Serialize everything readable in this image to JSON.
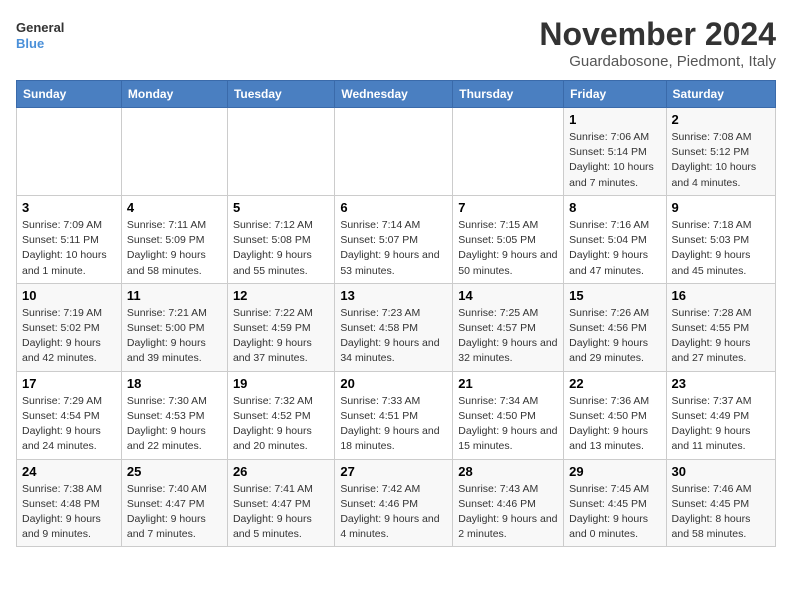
{
  "header": {
    "logo_line1": "General",
    "logo_line2": "Blue",
    "month_title": "November 2024",
    "location": "Guardabosone, Piedmont, Italy"
  },
  "weekdays": [
    "Sunday",
    "Monday",
    "Tuesday",
    "Wednesday",
    "Thursday",
    "Friday",
    "Saturday"
  ],
  "weeks": [
    [
      {
        "day": "",
        "info": ""
      },
      {
        "day": "",
        "info": ""
      },
      {
        "day": "",
        "info": ""
      },
      {
        "day": "",
        "info": ""
      },
      {
        "day": "",
        "info": ""
      },
      {
        "day": "1",
        "info": "Sunrise: 7:06 AM\nSunset: 5:14 PM\nDaylight: 10 hours and 7 minutes."
      },
      {
        "day": "2",
        "info": "Sunrise: 7:08 AM\nSunset: 5:12 PM\nDaylight: 10 hours and 4 minutes."
      }
    ],
    [
      {
        "day": "3",
        "info": "Sunrise: 7:09 AM\nSunset: 5:11 PM\nDaylight: 10 hours and 1 minute."
      },
      {
        "day": "4",
        "info": "Sunrise: 7:11 AM\nSunset: 5:09 PM\nDaylight: 9 hours and 58 minutes."
      },
      {
        "day": "5",
        "info": "Sunrise: 7:12 AM\nSunset: 5:08 PM\nDaylight: 9 hours and 55 minutes."
      },
      {
        "day": "6",
        "info": "Sunrise: 7:14 AM\nSunset: 5:07 PM\nDaylight: 9 hours and 53 minutes."
      },
      {
        "day": "7",
        "info": "Sunrise: 7:15 AM\nSunset: 5:05 PM\nDaylight: 9 hours and 50 minutes."
      },
      {
        "day": "8",
        "info": "Sunrise: 7:16 AM\nSunset: 5:04 PM\nDaylight: 9 hours and 47 minutes."
      },
      {
        "day": "9",
        "info": "Sunrise: 7:18 AM\nSunset: 5:03 PM\nDaylight: 9 hours and 45 minutes."
      }
    ],
    [
      {
        "day": "10",
        "info": "Sunrise: 7:19 AM\nSunset: 5:02 PM\nDaylight: 9 hours and 42 minutes."
      },
      {
        "day": "11",
        "info": "Sunrise: 7:21 AM\nSunset: 5:00 PM\nDaylight: 9 hours and 39 minutes."
      },
      {
        "day": "12",
        "info": "Sunrise: 7:22 AM\nSunset: 4:59 PM\nDaylight: 9 hours and 37 minutes."
      },
      {
        "day": "13",
        "info": "Sunrise: 7:23 AM\nSunset: 4:58 PM\nDaylight: 9 hours and 34 minutes."
      },
      {
        "day": "14",
        "info": "Sunrise: 7:25 AM\nSunset: 4:57 PM\nDaylight: 9 hours and 32 minutes."
      },
      {
        "day": "15",
        "info": "Sunrise: 7:26 AM\nSunset: 4:56 PM\nDaylight: 9 hours and 29 minutes."
      },
      {
        "day": "16",
        "info": "Sunrise: 7:28 AM\nSunset: 4:55 PM\nDaylight: 9 hours and 27 minutes."
      }
    ],
    [
      {
        "day": "17",
        "info": "Sunrise: 7:29 AM\nSunset: 4:54 PM\nDaylight: 9 hours and 24 minutes."
      },
      {
        "day": "18",
        "info": "Sunrise: 7:30 AM\nSunset: 4:53 PM\nDaylight: 9 hours and 22 minutes."
      },
      {
        "day": "19",
        "info": "Sunrise: 7:32 AM\nSunset: 4:52 PM\nDaylight: 9 hours and 20 minutes."
      },
      {
        "day": "20",
        "info": "Sunrise: 7:33 AM\nSunset: 4:51 PM\nDaylight: 9 hours and 18 minutes."
      },
      {
        "day": "21",
        "info": "Sunrise: 7:34 AM\nSunset: 4:50 PM\nDaylight: 9 hours and 15 minutes."
      },
      {
        "day": "22",
        "info": "Sunrise: 7:36 AM\nSunset: 4:50 PM\nDaylight: 9 hours and 13 minutes."
      },
      {
        "day": "23",
        "info": "Sunrise: 7:37 AM\nSunset: 4:49 PM\nDaylight: 9 hours and 11 minutes."
      }
    ],
    [
      {
        "day": "24",
        "info": "Sunrise: 7:38 AM\nSunset: 4:48 PM\nDaylight: 9 hours and 9 minutes."
      },
      {
        "day": "25",
        "info": "Sunrise: 7:40 AM\nSunset: 4:47 PM\nDaylight: 9 hours and 7 minutes."
      },
      {
        "day": "26",
        "info": "Sunrise: 7:41 AM\nSunset: 4:47 PM\nDaylight: 9 hours and 5 minutes."
      },
      {
        "day": "27",
        "info": "Sunrise: 7:42 AM\nSunset: 4:46 PM\nDaylight: 9 hours and 4 minutes."
      },
      {
        "day": "28",
        "info": "Sunrise: 7:43 AM\nSunset: 4:46 PM\nDaylight: 9 hours and 2 minutes."
      },
      {
        "day": "29",
        "info": "Sunrise: 7:45 AM\nSunset: 4:45 PM\nDaylight: 9 hours and 0 minutes."
      },
      {
        "day": "30",
        "info": "Sunrise: 7:46 AM\nSunset: 4:45 PM\nDaylight: 8 hours and 58 minutes."
      }
    ]
  ]
}
